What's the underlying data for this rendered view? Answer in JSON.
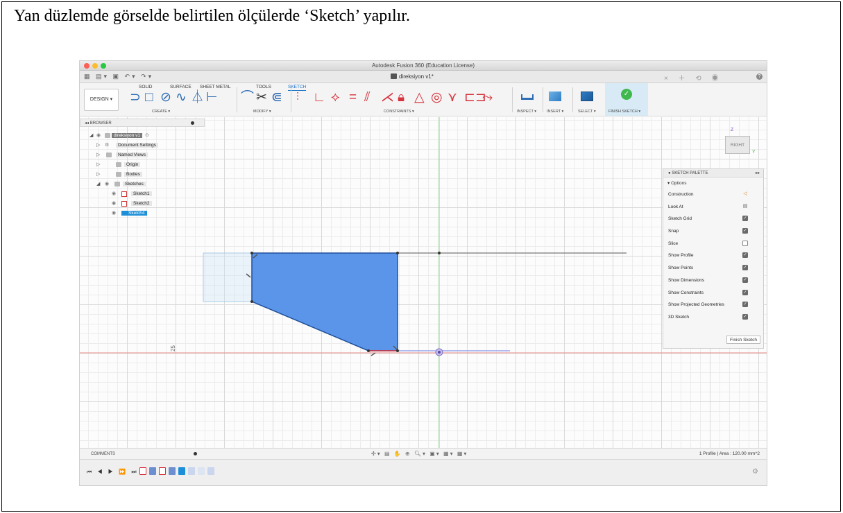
{
  "caption": "Yan düzlemde görselde belirtilen ölçülerde ‘Sketch’ yapılır.",
  "window": {
    "title": "Autodesk Fusion 360 (Education License)",
    "document_tab": "direksiyon v1*"
  },
  "ribbon": {
    "workspace": "DESIGN ▾",
    "tabs": [
      {
        "label": "SOLID",
        "active": false
      },
      {
        "label": "SURFACE",
        "active": false
      },
      {
        "label": "SHEET METAL",
        "active": false
      },
      {
        "label": "TOOLS",
        "active": false
      },
      {
        "label": "SKETCH",
        "active": true
      }
    ],
    "groups": {
      "create": "CREATE ▾",
      "modify": "MODIFY ▾",
      "constraints": "CONSTRAINTS ▾",
      "inspect": "INSPECT ▾",
      "insert": "INSERT ▾",
      "select": "SELECT ▾",
      "finish_sketch": "FINISH SKETCH ▾"
    },
    "colors": {
      "accent": "#1a73c9",
      "constraint_red": "#d8323c",
      "finish_green": "#3fb94d"
    }
  },
  "browser": {
    "header": "BROWSER",
    "items": [
      {
        "label": "direksiyon v1",
        "level": 0,
        "style": "root"
      },
      {
        "label": "Document Settings",
        "level": 1,
        "style": "shaded"
      },
      {
        "label": "Named Views",
        "level": 1,
        "style": "shaded"
      },
      {
        "label": "Origin",
        "level": 1,
        "style": "shaded"
      },
      {
        "label": "Bodies",
        "level": 1,
        "style": "shaded"
      },
      {
        "label": "Sketches",
        "level": 1,
        "style": "shaded"
      },
      {
        "label": "Sketch1",
        "level": 2,
        "style": "shaded"
      },
      {
        "label": "Sketch2",
        "level": 2,
        "style": "shaded"
      },
      {
        "label": "Sketch4",
        "level": 2,
        "style": "selected"
      }
    ]
  },
  "viewcube": {
    "face": "RIGHT",
    "axis_z": "Z",
    "axis_y": "Y"
  },
  "sketch_palette": {
    "title": "SKETCH PALETTE",
    "section": "▾ Options",
    "rows": [
      {
        "label": "Construction",
        "control": "construction-icon"
      },
      {
        "label": "Look At",
        "control": "look-at-icon"
      },
      {
        "label": "Sketch Grid",
        "control": "checked"
      },
      {
        "label": "Snap",
        "control": "checked"
      },
      {
        "label": "Slice",
        "control": "unchecked"
      },
      {
        "label": "Show Profile",
        "control": "checked"
      },
      {
        "label": "Show Points",
        "control": "checked"
      },
      {
        "label": "Show Dimensions",
        "control": "checked"
      },
      {
        "label": "Show Constraints",
        "control": "checked"
      },
      {
        "label": "Show Projected Geometries",
        "control": "checked"
      },
      {
        "label": "3D Sketch",
        "control": "checked"
      }
    ],
    "finish_button": "Finish Sketch"
  },
  "canvas": {
    "dimension_label": "25",
    "profile_color": "#5b95e9"
  },
  "comments": {
    "label": "COMMENTS"
  },
  "status": "1 Profile | Area : 120.00 mm^2"
}
